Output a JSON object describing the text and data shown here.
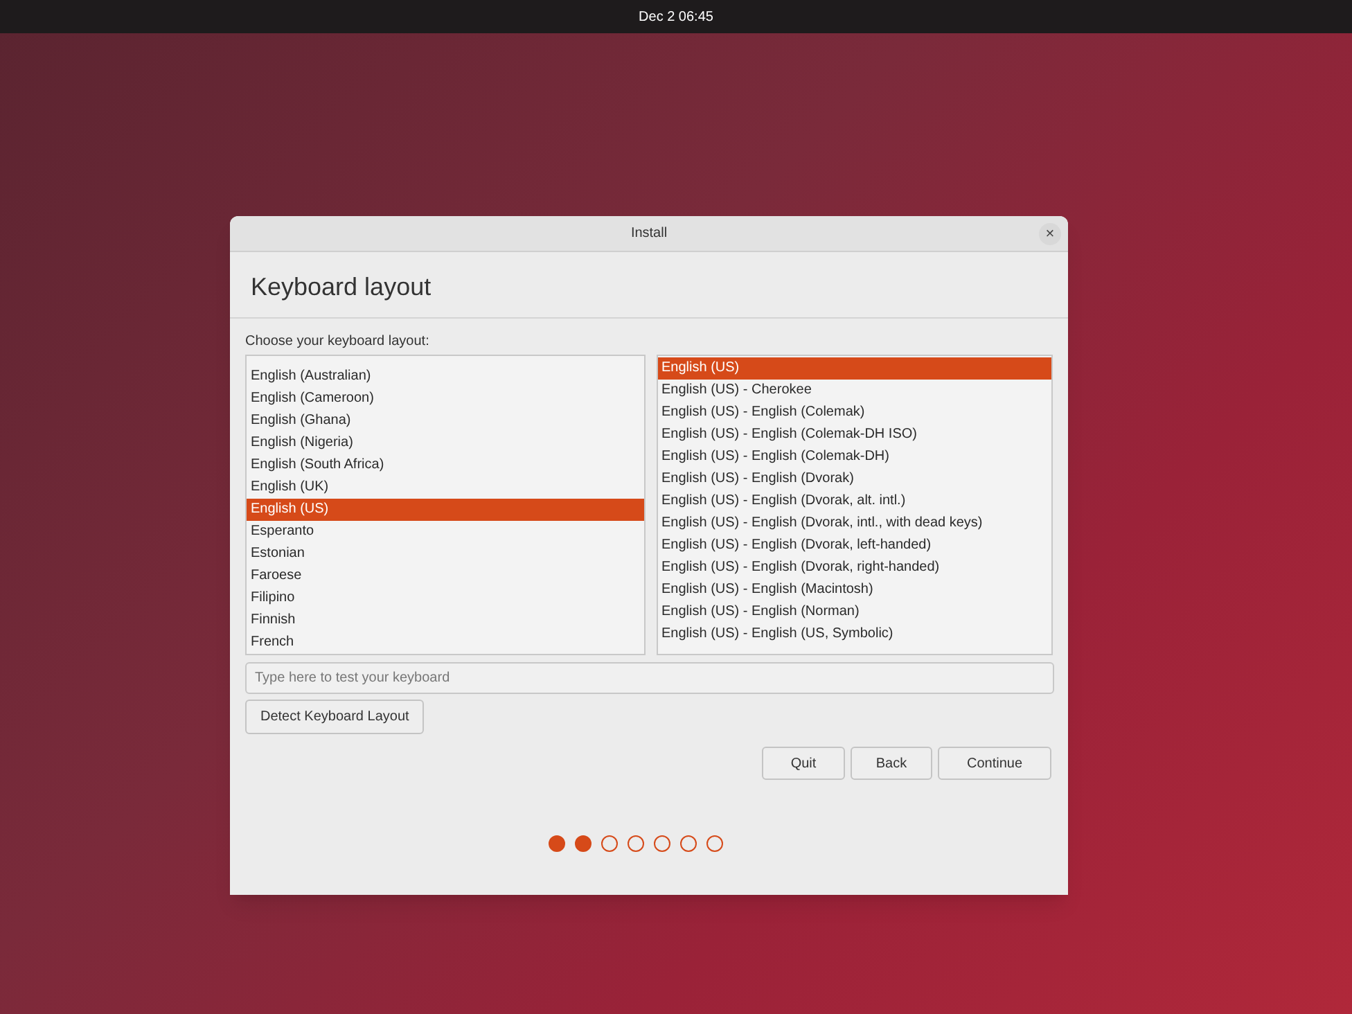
{
  "top_bar": {
    "clock": "Dec 2  06:45"
  },
  "window": {
    "title": "Install",
    "close": "×"
  },
  "heading": "Keyboard layout",
  "prompt": "Choose your keyboard layout:",
  "layouts": [
    {
      "label": "English (Australian)",
      "selected": false
    },
    {
      "label": "English (Cameroon)",
      "selected": false
    },
    {
      "label": "English (Ghana)",
      "selected": false
    },
    {
      "label": "English (Nigeria)",
      "selected": false
    },
    {
      "label": "English (South Africa)",
      "selected": false
    },
    {
      "label": "English (UK)",
      "selected": false
    },
    {
      "label": "English (US)",
      "selected": true
    },
    {
      "label": "Esperanto",
      "selected": false
    },
    {
      "label": "Estonian",
      "selected": false
    },
    {
      "label": "Faroese",
      "selected": false
    },
    {
      "label": "Filipino",
      "selected": false
    },
    {
      "label": "Finnish",
      "selected": false
    },
    {
      "label": "French",
      "selected": false
    }
  ],
  "variants": [
    {
      "label": "English (US)",
      "selected": true
    },
    {
      "label": "English (US) - Cherokee",
      "selected": false
    },
    {
      "label": "English (US) - English (Colemak)",
      "selected": false
    },
    {
      "label": "English (US) - English (Colemak-DH ISO)",
      "selected": false
    },
    {
      "label": "English (US) - English (Colemak-DH)",
      "selected": false
    },
    {
      "label": "English (US) - English (Dvorak)",
      "selected": false
    },
    {
      "label": "English (US) - English (Dvorak, alt. intl.)",
      "selected": false
    },
    {
      "label": "English (US) - English (Dvorak, intl., with dead keys)",
      "selected": false
    },
    {
      "label": "English (US) - English (Dvorak, left-handed)",
      "selected": false
    },
    {
      "label": "English (US) - English (Dvorak, right-handed)",
      "selected": false
    },
    {
      "label": "English (US) - English (Macintosh)",
      "selected": false
    },
    {
      "label": "English (US) - English (Norman)",
      "selected": false
    },
    {
      "label": "English (US) - English (US, Symbolic)",
      "selected": false
    }
  ],
  "test_field": {
    "placeholder": "Type here to test your keyboard"
  },
  "detect_button": "Detect Keyboard Layout",
  "buttons": [
    "Quit",
    "Back",
    "Continue"
  ],
  "steps": [
    {
      "filled": true
    },
    {
      "filled": true
    },
    {
      "filled": false
    },
    {
      "filled": false
    },
    {
      "filled": false
    },
    {
      "filled": false
    },
    {
      "filled": false
    }
  ]
}
